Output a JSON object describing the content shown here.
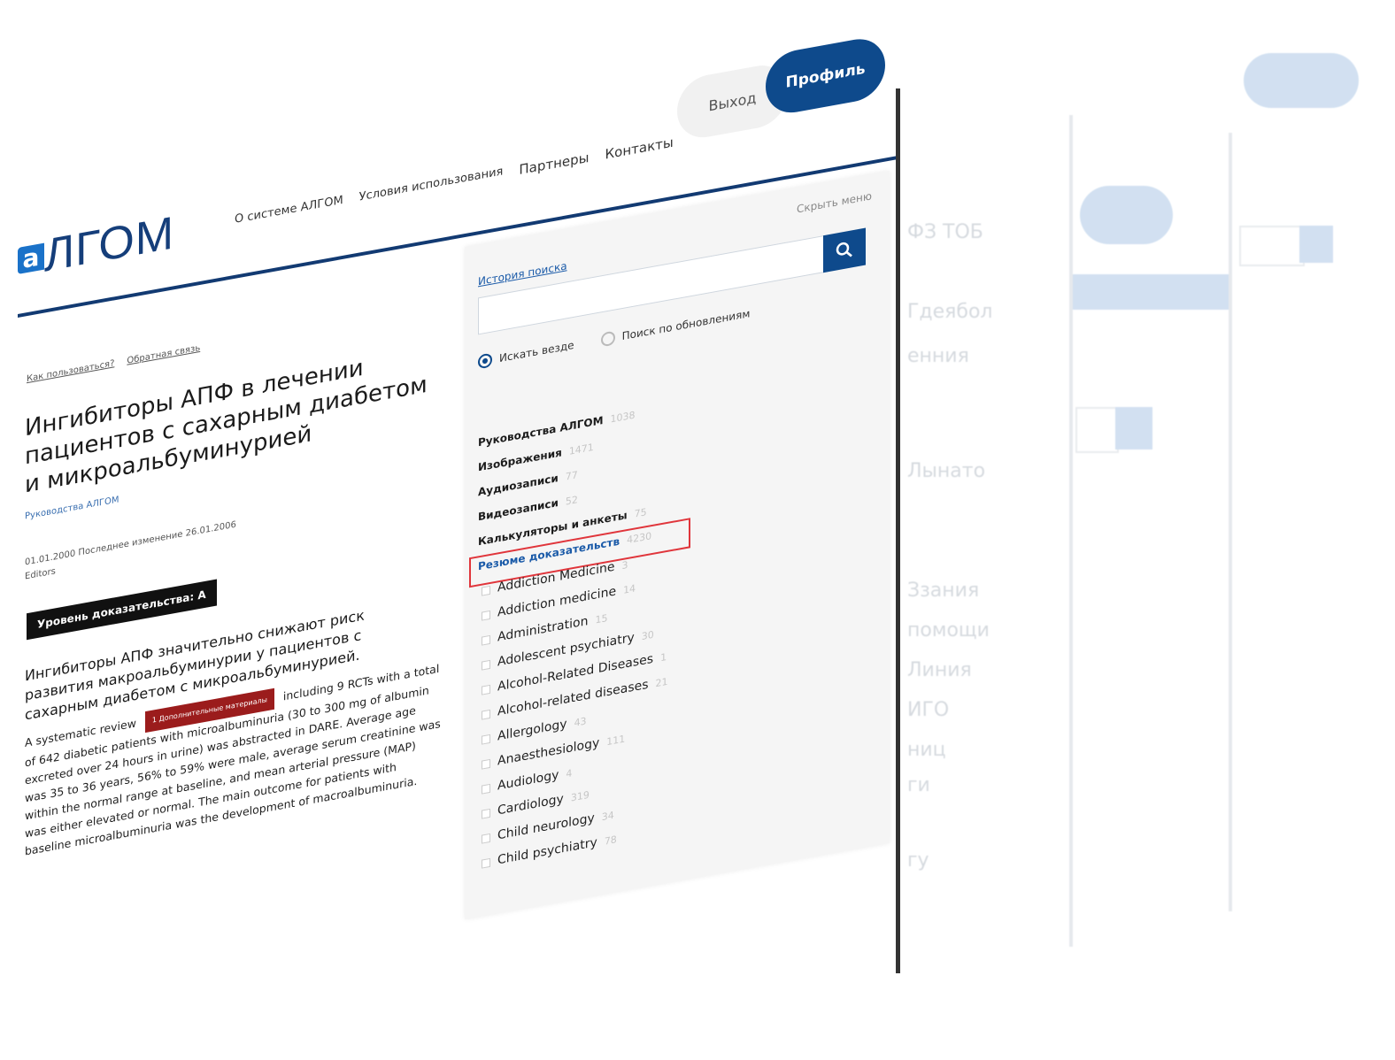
{
  "logo": {
    "mark": "a",
    "text": "ЛГОМ"
  },
  "nav": {
    "about": "О системе АЛГОМ",
    "terms": "Условия использования",
    "partners": "Партнеры",
    "contacts": "Контакты"
  },
  "header": {
    "exit_label": "Выход",
    "profile_label": "Профиль"
  },
  "crumbs": {
    "how_to": "Как пользоваться?",
    "feedback": "Обратная связь"
  },
  "article": {
    "title": "Ингибиторы АПФ в лечении пациентов с сахарным диабетом и микроальбуминурией",
    "subtitle": "Руководства АЛГОМ",
    "dates": "01.01.2000  Последнее изменение 26.01.2006",
    "authors": "Editors",
    "evidence_level": "Уровень доказательства: A",
    "lead": "Ингибиторы АПФ значительно снижают риск развития макроальбуминурии у пациентов с сахарным диабетом с микроальбуминурией.",
    "body_start": "A systematic review",
    "tag": "1 Дополнительные материалы",
    "body_rest": "including 9 RCTs with a total of 642 diabetic patients with microalbuminuria (30 to 300 mg of albumin excreted over 24 hours in urine) was abstracted in DARE. Average age was 35 to 36 years, 56% to 59% were male, average serum creatinine was within the normal range at baseline, and mean arterial pressure (MAP) was either elevated or normal. The main outcome for patients with baseline microalbuminuria was the development of macroalbuminuria."
  },
  "search": {
    "hide_menu": "Скрыть меню",
    "history": "История поиска",
    "placeholder": "",
    "radio_everywhere": "Искать везде",
    "radio_updates": "Поиск по обновлениям"
  },
  "categories": [
    {
      "label": "Руководства АЛГОМ",
      "count": "1038"
    },
    {
      "label": "Изображения",
      "count": "1471"
    },
    {
      "label": "Аудиозаписи",
      "count": "77"
    },
    {
      "label": "Видеозаписи",
      "count": "52"
    },
    {
      "label": "Калькуляторы и анкеты",
      "count": "75"
    },
    {
      "label": "Резюме доказательств",
      "count": "4230"
    }
  ],
  "subcategories": [
    {
      "label": "Addiction Medicine",
      "count": "3"
    },
    {
      "label": "Addiction medicine",
      "count": "14"
    },
    {
      "label": "Administration",
      "count": "15"
    },
    {
      "label": "Adolescent psychiatry",
      "count": "30"
    },
    {
      "label": "Alcohol-Related Diseases",
      "count": "1"
    },
    {
      "label": "Alcohol-related diseases",
      "count": "21"
    },
    {
      "label": "Allergology",
      "count": "43"
    },
    {
      "label": "Anaesthesiology",
      "count": "111"
    },
    {
      "label": "Audiology",
      "count": "4"
    },
    {
      "label": "Cardiology",
      "count": "319"
    },
    {
      "label": "Child neurology",
      "count": "34"
    },
    {
      "label": "Child psychiatry",
      "count": "78"
    }
  ],
  "ghost": {
    "t1": "ФЗ ТОБ",
    "t2": "Гдеябол",
    "t3": "енния",
    "t4": "Лынато",
    "t5": "Ззания",
    "t6": "помощи",
    "t7": "Линия",
    "t8": "ИГО",
    "t9": "ниц",
    "t10": "ги",
    "t11": "гу"
  }
}
